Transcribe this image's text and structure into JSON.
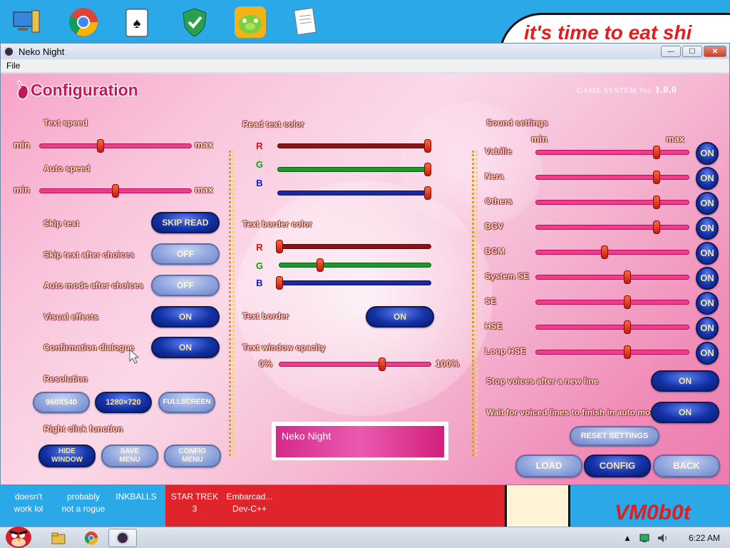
{
  "desktop": {
    "banner_text": "it's time to eat shi",
    "brand_text": "VM0b0t",
    "labels": [
      {
        "lines": [
          "doesn't",
          "work lol"
        ]
      },
      {
        "lines": [
          "probably",
          "not a rogue"
        ]
      },
      {
        "lines": [
          "INKBALLS"
        ]
      },
      {
        "lines": [
          "STAR TREK",
          "3"
        ]
      },
      {
        "lines": [
          "Embarcad...",
          "Dev-C++"
        ]
      }
    ]
  },
  "window": {
    "title": "Neko Night",
    "menu": [
      "File"
    ],
    "controls": {
      "minimize": "—",
      "maximize": "☐",
      "close": "✕"
    }
  },
  "config": {
    "title": "Configuration",
    "version_label": "GAME SYSTEM Ver.",
    "version_num": "1.0.0",
    "left": {
      "text_speed_label": "Text speed",
      "text_speed_value": 0.4,
      "auto_speed_label": "Auto speed",
      "auto_speed_value": 0.5,
      "min_label": "min",
      "max_label": "max",
      "toggles": [
        {
          "label": "Skip text",
          "value": "SKIP READ",
          "state": "on"
        },
        {
          "label": "Skip text after choices",
          "value": "OFF",
          "state": "off"
        },
        {
          "label": "Auto mode after choices",
          "value": "OFF",
          "state": "off"
        },
        {
          "label": "Visual effects",
          "value": "ON",
          "state": "on"
        },
        {
          "label": "Confirmation dialogue",
          "value": "ON",
          "state": "on"
        }
      ],
      "resolution_label": "Resolution",
      "resolutions": [
        "960X540",
        "1280×720",
        "FULLSCREEN"
      ],
      "resolution_active": 1,
      "right_click_label": "Right click function",
      "right_click_options": [
        {
          "lines": [
            "HIDE",
            "WINDOW"
          ],
          "active": true
        },
        {
          "lines": [
            "SAVE",
            "MENU"
          ],
          "active": false
        },
        {
          "lines": [
            "CONFIG",
            "MENU"
          ],
          "active": false
        }
      ]
    },
    "middle": {
      "read_color_label": "Read text color",
      "read_color": {
        "R": 1.0,
        "G": 1.0,
        "B": 1.0
      },
      "border_color_label": "Text border color",
      "border_color": {
        "R": 0.0,
        "G": 0.27,
        "B": 0.0
      },
      "text_border_label": "Text border",
      "text_border_value": "ON",
      "opacity_label": "Text window opacity",
      "opacity_min": "0%",
      "opacity_max": "100%",
      "opacity_value": 0.68,
      "preview_text": "Neko Night"
    },
    "right": {
      "sound_label": "Sound settings",
      "min_label": "min",
      "max_label": "max",
      "channels": [
        {
          "name": "Vabille",
          "level": 0.79,
          "state": "ON"
        },
        {
          "name": "Nera",
          "level": 0.79,
          "state": "ON"
        },
        {
          "name": "Others",
          "level": 0.79,
          "state": "ON"
        },
        {
          "name": "BGV",
          "level": 0.79,
          "state": "ON"
        },
        {
          "name": "BGM",
          "level": 0.45,
          "state": "ON"
        },
        {
          "name": "System SE",
          "level": 0.6,
          "state": "ON"
        },
        {
          "name": "SE",
          "level": 0.6,
          "state": "ON"
        },
        {
          "name": "HSE",
          "level": 0.6,
          "state": "ON"
        },
        {
          "name": "Loop HSE",
          "level": 0.6,
          "state": "ON"
        }
      ],
      "stop_voices_label": "Stop voices after a new line",
      "stop_voices_value": "ON",
      "wait_voiced_label": "Wait for voiced lines to finish in auto mode",
      "wait_voiced_value": "ON",
      "reset_label": "RESET SETTINGS",
      "nav": [
        {
          "label": "LOAD",
          "active": false
        },
        {
          "label": "CONFIG",
          "active": true
        },
        {
          "label": "BACK",
          "active": false
        }
      ]
    }
  },
  "taskbar": {
    "time": "6:22 AM"
  },
  "colors": {
    "accent_pink": "#f03c8a",
    "button_blue": "#1433a8",
    "label_gold": "#f7e6a8",
    "title_magenta": "#c2185b"
  }
}
